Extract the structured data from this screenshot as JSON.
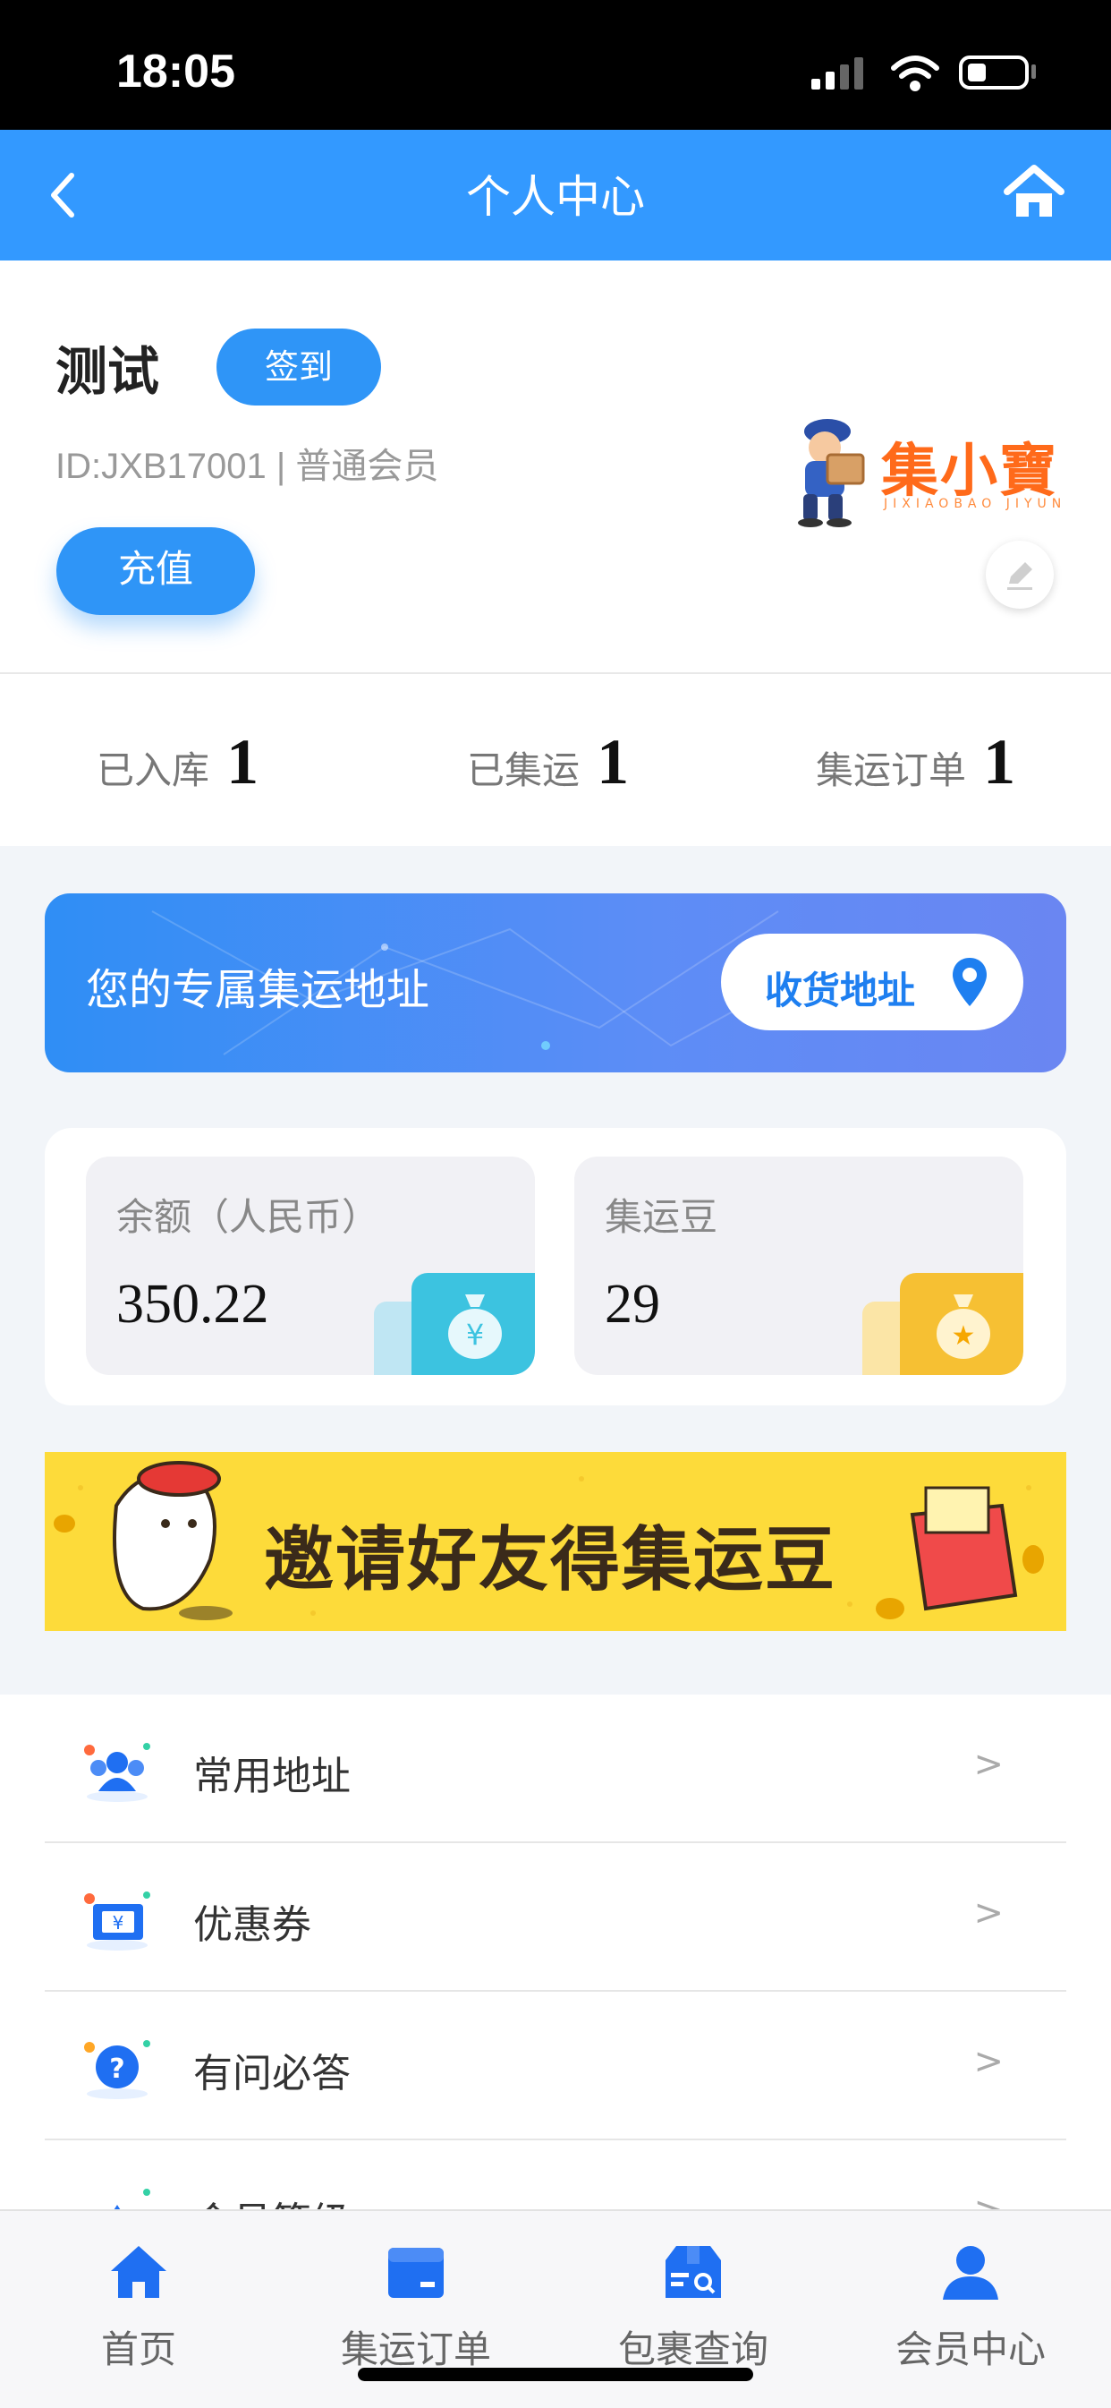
{
  "status_bar": {
    "time": "18:05"
  },
  "nav": {
    "title": "个人中心"
  },
  "profile": {
    "name": "测试",
    "signin_label": "签到",
    "meta": "ID:JXB17001 | 普通会员",
    "recharge_label": "充值",
    "logo_text": "集小寶",
    "logo_subtext": "JIXIAOBAO JIYUN"
  },
  "stats": [
    {
      "label": "已入库",
      "value": "1"
    },
    {
      "label": "已集运",
      "value": "1"
    },
    {
      "label": "集运订单",
      "value": "1"
    }
  ],
  "address_banner": {
    "text": "您的专属集运地址",
    "button_label": "收货地址"
  },
  "wallet": [
    {
      "label": "余额（人民币）",
      "value": "350.22",
      "icon": "money-bag-yuan-icon",
      "accent": "#3cc3e0"
    },
    {
      "label": "集运豆",
      "value": "29",
      "icon": "money-bag-star-icon",
      "accent": "#f6c033"
    }
  ],
  "invite_banner": {
    "text": "邀请好友得集运豆"
  },
  "menu": [
    {
      "label": "常用地址",
      "arrow": ">"
    },
    {
      "label": "优惠券",
      "arrow": ">"
    },
    {
      "label": "有问必答",
      "arrow": ">"
    },
    {
      "label": "会员等级",
      "arrow": ">"
    }
  ],
  "tabs": [
    {
      "label": "首页",
      "icon": "home-icon"
    },
    {
      "label": "集运订单",
      "icon": "order-box-icon"
    },
    {
      "label": "包裹查询",
      "icon": "package-search-icon"
    },
    {
      "label": "会员中心",
      "icon": "member-icon"
    }
  ],
  "colors": {
    "primary": "#3399ff",
    "button": "#2f95f7",
    "brand_orange": "#ff6a1a",
    "invite_yellow": "#fddb3a"
  }
}
